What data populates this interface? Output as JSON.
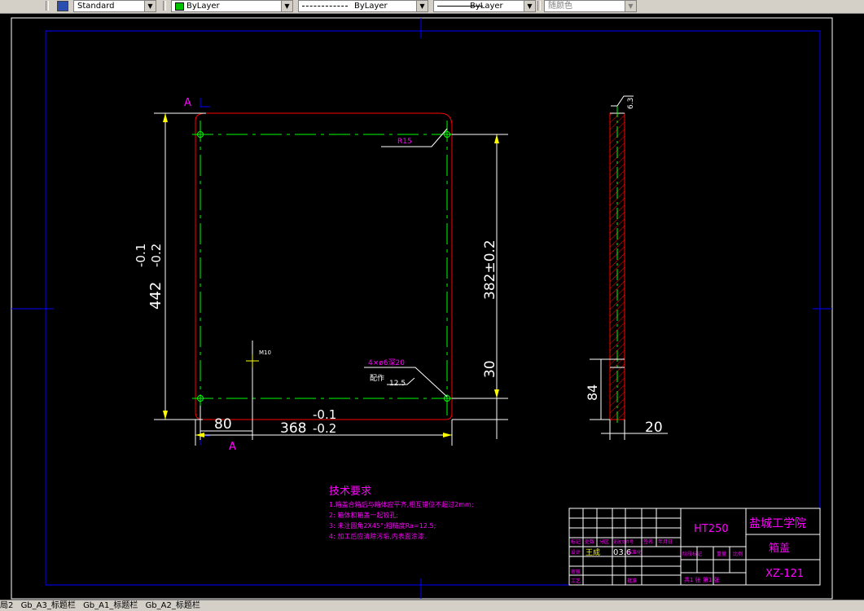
{
  "toolbar": {
    "style_combo": "Standard",
    "layer_color_combo": "ByLayer",
    "linetype_combo": "ByLayer",
    "lineweight_combo": "ByLayer",
    "plotstyle_combo": "随颜色"
  },
  "layout_tabs": [
    "局2",
    "Gb_A3_标题栏",
    "Gb_A1_标题栏",
    "Gb_A2_标题栏"
  ],
  "drawing": {
    "section_mark_top": "A",
    "section_mark_bottom": "A",
    "dim_overall_height": "442",
    "dim_overall_height_tol_upper": "-0.1",
    "dim_overall_height_tol_lower": "-0.2",
    "dim_hole_spacing_v": "382±0.2",
    "dim_30": "30",
    "dim_80": "80",
    "dim_width": "368",
    "dim_width_tol_upper": "-0.1",
    "dim_width_tol_lower": "-0.2",
    "label_r15": "R15",
    "label_m10": "M10",
    "label_holes": "4×ø6深20",
    "label_match": "配作",
    "label_roughness_12_5": "12.5",
    "label_roughness_6_3": "6.3",
    "dim_84": "84",
    "dim_20": "20"
  },
  "tech_requirements": {
    "title": "技术要求",
    "items": [
      "1.箱盖合箱后与箱体应平齐,相互错位不超过2mm;",
      "2: 箱体和箱盖一起铰孔;",
      "3: 未注圆角2X45°;粗糙度Ra=12.5;",
      "4: 加工后应清除污垢,内表面涂漆."
    ]
  },
  "title_block": {
    "material": "HT250",
    "school": "盐城工学院",
    "part_name": "箱盖",
    "drawing_no": "XZ-121",
    "hdr_mark": "标记",
    "hdr_count": "处数",
    "hdr_zone": "分区",
    "hdr_change_doc": "更改文件号",
    "hdr_sign": "签名",
    "hdr_date": "年月日",
    "design_label": "设计",
    "designer": "王成",
    "design_date": "03.6",
    "std_label": "标准化",
    "stage_mark": "阶段标记",
    "weight": "重量",
    "scale": "比例",
    "review_label": "审核",
    "process_label": "工艺",
    "approve_label": "批准",
    "sheet_info": "共1  张  第1  张"
  }
}
